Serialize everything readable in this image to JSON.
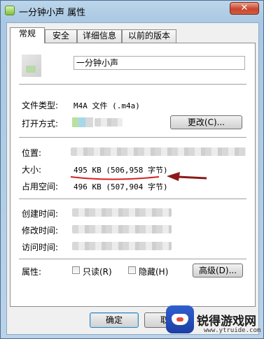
{
  "window": {
    "title": "一分钟小声 属性",
    "close_label": "✕"
  },
  "tabs": [
    {
      "label": "常规",
      "active": true
    },
    {
      "label": "安全",
      "active": false
    },
    {
      "label": "详细信息",
      "active": false
    },
    {
      "label": "以前的版本",
      "active": false
    }
  ],
  "general": {
    "filename": "一分钟小声",
    "file_type_label": "文件类型:",
    "file_type_value": "M4A 文件 (.m4a)",
    "open_with_label": "打开方式:",
    "change_button": "更改(C)...",
    "location_label": "位置:",
    "size_label": "大小:",
    "size_value": "495 KB (506,958 字节)",
    "size_on_disk_label": "占用空间:",
    "size_on_disk_value": "496 KB (507,904 字节)",
    "created_label": "创建时间:",
    "modified_label": "修改时间:",
    "accessed_label": "访问时间:",
    "attributes_label": "属性:",
    "readonly_label": "只读(R)",
    "hidden_label": "隐藏(H)",
    "advanced_button": "高级(D)..."
  },
  "footer": {
    "ok_button": "确定",
    "cancel_button": "取消"
  },
  "watermark": {
    "title": "锐得游戏网",
    "url": "www.ytruide.com"
  },
  "colors": {
    "annotation_red": "#d42020",
    "annotation_arrow": "#8b1a1a",
    "accent_blue": "#3c7fb1"
  }
}
